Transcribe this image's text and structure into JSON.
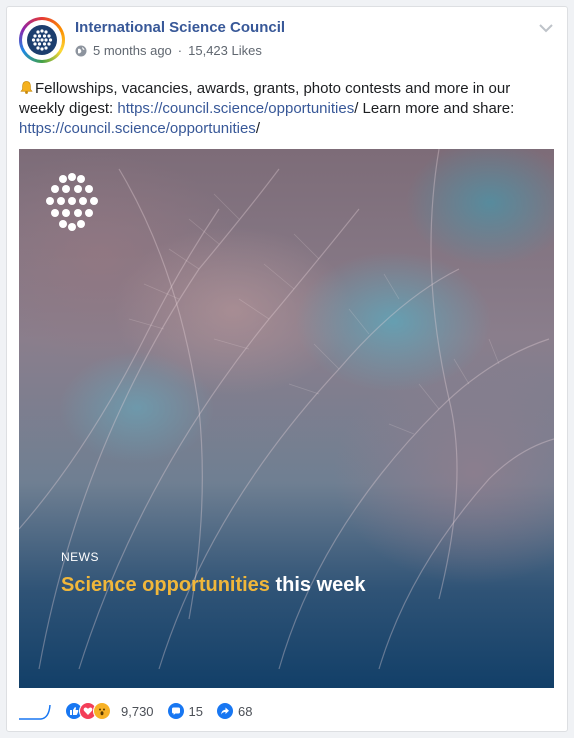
{
  "post": {
    "page_name": "International Science Council",
    "time": "5 months ago",
    "separator": "·",
    "likes": "15,423 Likes",
    "text_intro": "Fellowships, vacancies, awards, grants, photo contests and more in our weekly digest: ",
    "link1": "https://council.science/opportunities",
    "text_mid": "/ Learn more and share: ",
    "link2": "https://council.science/opportunities",
    "text_end": "/"
  },
  "image": {
    "kicker": "NEWS",
    "headline_highlight": "Science opportunities",
    "headline_rest": "this week",
    "colors": {
      "highlight": "#f1b73a",
      "text": "#ffffff",
      "bottom": "#123f68"
    }
  },
  "stats": {
    "reactions_count": "9,730",
    "comments_count": "15",
    "shares_count": "68",
    "reaction_icons": [
      "like-icon",
      "love-icon",
      "wow-icon"
    ]
  },
  "colors": {
    "link": "#385898",
    "accent": "#1877f2"
  }
}
